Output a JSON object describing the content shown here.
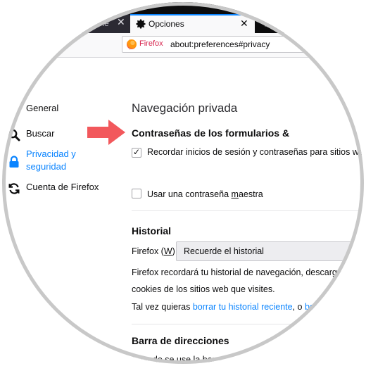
{
  "tabs": {
    "previous": {
      "label": "oble",
      "close_glyph": "✕"
    },
    "active": {
      "label": "Opciones",
      "icon": "gear-icon",
      "close_glyph": "✕"
    },
    "new_tab_glyph": "+"
  },
  "urlbar": {
    "identity_label": "Firefox",
    "identity_icon": "firefox-logo-icon",
    "url": "about:preferences#privacy"
  },
  "sidebar": {
    "items": [
      {
        "label": "General",
        "icon": "",
        "selected": false
      },
      {
        "label": "Buscar",
        "icon": "search-icon",
        "selected": false
      },
      {
        "label_line1": "Privacidad y",
        "label_line2": "seguridad",
        "icon": "lock-icon",
        "selected": true
      },
      {
        "label": "Cuenta de Firefox",
        "icon": "sync-icon",
        "selected": false
      }
    ]
  },
  "main": {
    "heading": "Navegación privada",
    "pointer_icon": "pointer-arrow-icon",
    "passwords": {
      "title": "Contraseñas de los formularios &",
      "remember_label": "Recordar inicios de sesión y contraseñas para sitios web",
      "remember_checked": true,
      "tick_glyph": "✓",
      "master_label_pre": "Usar una contraseña ",
      "master_label_key": "m",
      "master_label_post": "aestra",
      "master_checked": false
    },
    "history": {
      "title": "Historial",
      "firefox_label_pre": "Firefox (",
      "firefox_label_key": "W",
      "firefox_label_post": ")",
      "select_value": "Recuerde el historial",
      "line1": "Firefox recordará tu historial de navegación, descargas, f",
      "line2": "cookies de los sitios web que visites.",
      "line3_pre": "Tal vez quieras ",
      "line3_link1": "borrar tu historial reciente",
      "line3_mid": ", o ",
      "line3_link2": "borra"
    },
    "address_bar": {
      "title": "Barra de direcciones",
      "line1": "Cuando se use la barra"
    }
  },
  "colors": {
    "accent": "#0a84ff",
    "arrow": "#f2585c",
    "tabstrip": "#0c0c0d",
    "identity_text": "#d7264f"
  }
}
